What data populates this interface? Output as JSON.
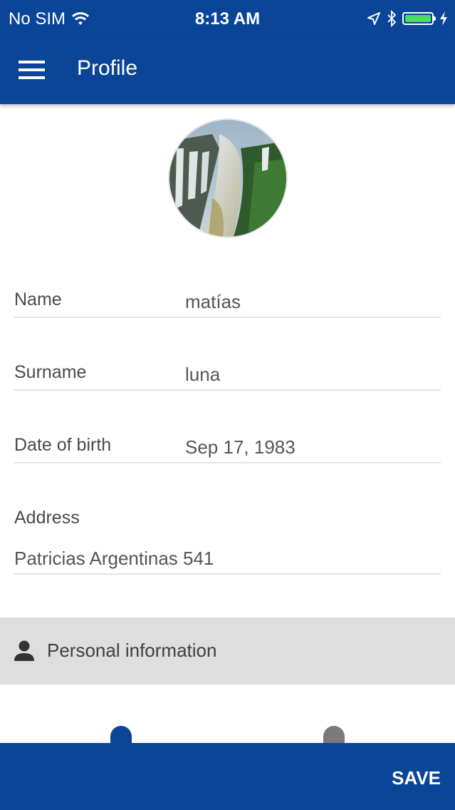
{
  "status_bar": {
    "carrier": "No SIM",
    "time": "8:13 AM",
    "battery_color": "#4cd964",
    "icons": [
      "wifi-icon",
      "location-icon",
      "bluetooth-icon",
      "battery-icon",
      "charging-icon"
    ]
  },
  "app_bar": {
    "title": "Profile",
    "menu_icon": "hamburger-menu-icon",
    "background": "#0a4597"
  },
  "avatar": {
    "description_icon": "waterfall-photo"
  },
  "form": {
    "name": {
      "label": "Name",
      "value": "matías"
    },
    "surname": {
      "label": "Surname",
      "value": "luna"
    },
    "date_of_birth": {
      "label": "Date of birth",
      "value": "Sep 17, 1983"
    },
    "address": {
      "label": "Address",
      "value": "Patricias Argentinas 541"
    }
  },
  "section": {
    "icon": "person-icon",
    "label": "Personal information"
  },
  "bottom_bar": {
    "save_label": "SAVE"
  }
}
